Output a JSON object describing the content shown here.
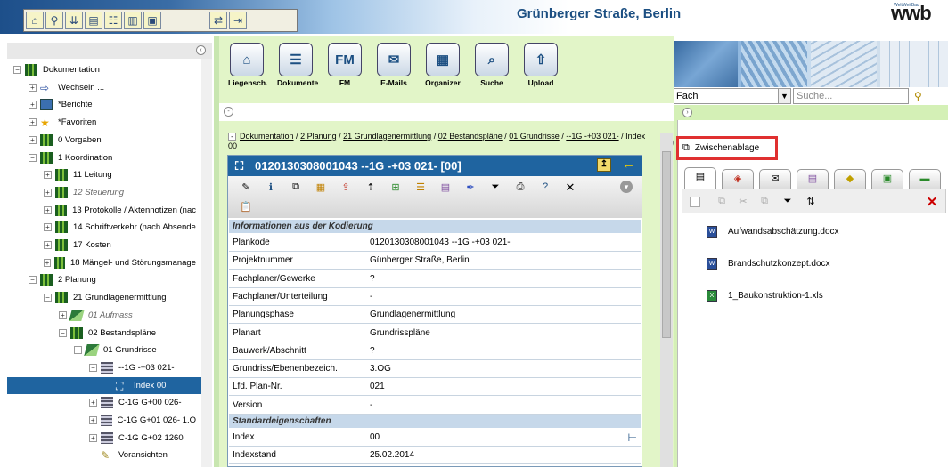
{
  "header": {
    "title": "Grünberger Straße, Berlin",
    "logo": "wwb",
    "logo_small": "WeltWeitBau",
    "toolbar_icons": [
      "home-icon",
      "search-people-icon",
      "filter-icon",
      "documents-icon",
      "tasks-icon",
      "abo-icon",
      "calendar-icon",
      "exchange-icon",
      "import-icon"
    ]
  },
  "tree": {
    "items": [
      {
        "label": "Dokumentation",
        "icon": "books",
        "indent": 0,
        "pm": "-"
      },
      {
        "label": "Wechseln ...",
        "icon": "arrow",
        "indent": 1,
        "pm": "+"
      },
      {
        "label": "*Berichte",
        "icon": "report",
        "indent": 1,
        "pm": "+"
      },
      {
        "label": "*Favoriten",
        "icon": "star",
        "indent": 1,
        "pm": "+"
      },
      {
        "label": "0 Vorgaben",
        "icon": "books",
        "indent": 1,
        "pm": "+"
      },
      {
        "label": "1 Koordination",
        "icon": "books",
        "indent": 1,
        "pm": "-"
      },
      {
        "label": "11 Leitung",
        "icon": "books",
        "indent": 2,
        "pm": "+"
      },
      {
        "label": "12 Steuerung",
        "icon": "books",
        "indent": 2,
        "pm": "+",
        "gray": true
      },
      {
        "label": "13 Protokolle / Aktennotizen (nac",
        "icon": "books",
        "indent": 2,
        "pm": "+"
      },
      {
        "label": "14 Schriftverkehr (nach Absende",
        "icon": "books",
        "indent": 2,
        "pm": "+"
      },
      {
        "label": "17 Kosten",
        "icon": "books",
        "indent": 2,
        "pm": "+"
      },
      {
        "label": "18 Mängel- und Störungsmanage",
        "icon": "books",
        "indent": 2,
        "pm": "+"
      },
      {
        "label": "2 Planung",
        "icon": "books",
        "indent": 1,
        "pm": "-"
      },
      {
        "label": "21 Grundlagenermittlung",
        "icon": "books",
        "indent": 2,
        "pm": "-"
      },
      {
        "label": "01 Aufmass",
        "icon": "book",
        "indent": 3,
        "pm": "+",
        "gray": true
      },
      {
        "label": "02 Bestandspläne",
        "icon": "books",
        "indent": 3,
        "pm": "-"
      },
      {
        "label": "01 Grundrisse",
        "icon": "book",
        "indent": 4,
        "pm": "-"
      },
      {
        "label": "--1G -+03 021-",
        "icon": "stack",
        "indent": 5,
        "pm": "-"
      },
      {
        "label": "Index 00",
        "icon": "plan",
        "indent": 6,
        "pm": "",
        "selected": true
      },
      {
        "label": "C-1G G+00 026-",
        "icon": "stack",
        "indent": 5,
        "pm": "+"
      },
      {
        "label": "C-1G G+01 026- 1.O",
        "icon": "stack",
        "indent": 5,
        "pm": "+"
      },
      {
        "label": "C-1G G+02 1260",
        "icon": "stack",
        "indent": 5,
        "pm": "+"
      },
      {
        "label": "Voransichten",
        "icon": "pencil",
        "indent": 5,
        "pm": ""
      }
    ]
  },
  "main_toolbar": [
    {
      "label": "Liegensch.",
      "icon": "building-icon",
      "glyph": "⌂"
    },
    {
      "label": "Dokumente",
      "icon": "documents-icon",
      "glyph": "☰"
    },
    {
      "label": "FM",
      "icon": "fm-icon",
      "glyph": "FM"
    },
    {
      "label": "E-Mails",
      "icon": "email-icon",
      "glyph": "✉"
    },
    {
      "label": "Organizer",
      "icon": "organizer-icon",
      "glyph": "▦"
    },
    {
      "label": "Suche",
      "icon": "search-icon",
      "glyph": "⌕"
    },
    {
      "label": "Upload",
      "icon": "upload-icon",
      "glyph": "⇧"
    }
  ],
  "breadcrumb": {
    "items": [
      "Dokumentation",
      "2 Planung",
      "21 Grundlagenermittlung",
      "02 Bestandspläne",
      "01 Grundrisse",
      "--1G -+03 021-"
    ],
    "current": "Index 00",
    "sep": " / "
  },
  "document": {
    "title": "0120130308001043 --1G -+03 021- [00]",
    "sections": [
      {
        "title": "Informationen aus der Kodierung",
        "rows": [
          {
            "k": "Plankode",
            "v": "0120130308001043 --1G -+03 021-"
          },
          {
            "k": "Projektnummer",
            "v": "Günberger Straße, Berlin"
          },
          {
            "k": "Fachplaner/Gewerke",
            "v": "?"
          },
          {
            "k": "Fachplaner/Unterteilung",
            "v": "-"
          },
          {
            "k": "Planungsphase",
            "v": "Grundlagenermittlung"
          },
          {
            "k": "Planart",
            "v": "Grundrisspläne"
          },
          {
            "k": "Bauwerk/Abschnitt",
            "v": "?"
          },
          {
            "k": "Grundriss/Ebenenbezeich.",
            "v": "3.OG"
          },
          {
            "k": "Lfd. Plan-Nr.",
            "v": "021"
          },
          {
            "k": "Version",
            "v": "-"
          }
        ]
      },
      {
        "title": "Standardeigenschaften",
        "rows": [
          {
            "k": "Index",
            "v": "00"
          },
          {
            "k": "Indexstand",
            "v": "25.02.2014"
          }
        ]
      }
    ]
  },
  "search": {
    "category": "Fach",
    "placeholder": "Suche..."
  },
  "clipboard": {
    "title": "Zwischenablage",
    "files": [
      {
        "name": "Aufwandsabschätzung.docx",
        "type": "word"
      },
      {
        "name": "Brandschutzkonzept.docx",
        "type": "word"
      },
      {
        "name": "1_Baukonstruktion-1.xls",
        "type": "excel"
      }
    ]
  }
}
